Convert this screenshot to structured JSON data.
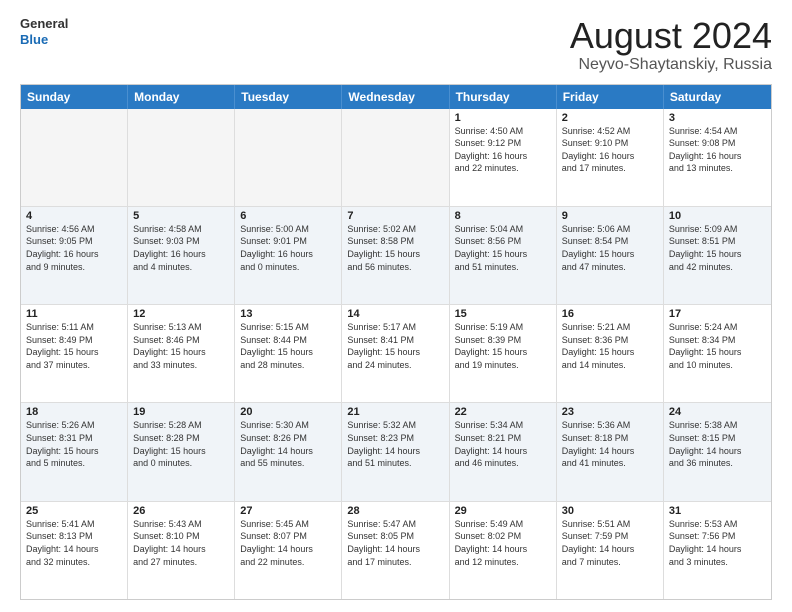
{
  "header": {
    "logo_line1": "General",
    "logo_line2": "Blue",
    "month": "August 2024",
    "location": "Neyvo-Shaytanskiy, Russia"
  },
  "weekdays": [
    "Sunday",
    "Monday",
    "Tuesday",
    "Wednesday",
    "Thursday",
    "Friday",
    "Saturday"
  ],
  "rows": [
    [
      {
        "day": "",
        "text": "",
        "empty": true
      },
      {
        "day": "",
        "text": "",
        "empty": true
      },
      {
        "day": "",
        "text": "",
        "empty": true
      },
      {
        "day": "",
        "text": "",
        "empty": true
      },
      {
        "day": "1",
        "text": "Sunrise: 4:50 AM\nSunset: 9:12 PM\nDaylight: 16 hours\nand 22 minutes."
      },
      {
        "day": "2",
        "text": "Sunrise: 4:52 AM\nSunset: 9:10 PM\nDaylight: 16 hours\nand 17 minutes."
      },
      {
        "day": "3",
        "text": "Sunrise: 4:54 AM\nSunset: 9:08 PM\nDaylight: 16 hours\nand 13 minutes."
      }
    ],
    [
      {
        "day": "4",
        "text": "Sunrise: 4:56 AM\nSunset: 9:05 PM\nDaylight: 16 hours\nand 9 minutes."
      },
      {
        "day": "5",
        "text": "Sunrise: 4:58 AM\nSunset: 9:03 PM\nDaylight: 16 hours\nand 4 minutes."
      },
      {
        "day": "6",
        "text": "Sunrise: 5:00 AM\nSunset: 9:01 PM\nDaylight: 16 hours\nand 0 minutes."
      },
      {
        "day": "7",
        "text": "Sunrise: 5:02 AM\nSunset: 8:58 PM\nDaylight: 15 hours\nand 56 minutes."
      },
      {
        "day": "8",
        "text": "Sunrise: 5:04 AM\nSunset: 8:56 PM\nDaylight: 15 hours\nand 51 minutes."
      },
      {
        "day": "9",
        "text": "Sunrise: 5:06 AM\nSunset: 8:54 PM\nDaylight: 15 hours\nand 47 minutes."
      },
      {
        "day": "10",
        "text": "Sunrise: 5:09 AM\nSunset: 8:51 PM\nDaylight: 15 hours\nand 42 minutes."
      }
    ],
    [
      {
        "day": "11",
        "text": "Sunrise: 5:11 AM\nSunset: 8:49 PM\nDaylight: 15 hours\nand 37 minutes."
      },
      {
        "day": "12",
        "text": "Sunrise: 5:13 AM\nSunset: 8:46 PM\nDaylight: 15 hours\nand 33 minutes."
      },
      {
        "day": "13",
        "text": "Sunrise: 5:15 AM\nSunset: 8:44 PM\nDaylight: 15 hours\nand 28 minutes."
      },
      {
        "day": "14",
        "text": "Sunrise: 5:17 AM\nSunset: 8:41 PM\nDaylight: 15 hours\nand 24 minutes."
      },
      {
        "day": "15",
        "text": "Sunrise: 5:19 AM\nSunset: 8:39 PM\nDaylight: 15 hours\nand 19 minutes."
      },
      {
        "day": "16",
        "text": "Sunrise: 5:21 AM\nSunset: 8:36 PM\nDaylight: 15 hours\nand 14 minutes."
      },
      {
        "day": "17",
        "text": "Sunrise: 5:24 AM\nSunset: 8:34 PM\nDaylight: 15 hours\nand 10 minutes."
      }
    ],
    [
      {
        "day": "18",
        "text": "Sunrise: 5:26 AM\nSunset: 8:31 PM\nDaylight: 15 hours\nand 5 minutes."
      },
      {
        "day": "19",
        "text": "Sunrise: 5:28 AM\nSunset: 8:28 PM\nDaylight: 15 hours\nand 0 minutes."
      },
      {
        "day": "20",
        "text": "Sunrise: 5:30 AM\nSunset: 8:26 PM\nDaylight: 14 hours\nand 55 minutes."
      },
      {
        "day": "21",
        "text": "Sunrise: 5:32 AM\nSunset: 8:23 PM\nDaylight: 14 hours\nand 51 minutes."
      },
      {
        "day": "22",
        "text": "Sunrise: 5:34 AM\nSunset: 8:21 PM\nDaylight: 14 hours\nand 46 minutes."
      },
      {
        "day": "23",
        "text": "Sunrise: 5:36 AM\nSunset: 8:18 PM\nDaylight: 14 hours\nand 41 minutes."
      },
      {
        "day": "24",
        "text": "Sunrise: 5:38 AM\nSunset: 8:15 PM\nDaylight: 14 hours\nand 36 minutes."
      }
    ],
    [
      {
        "day": "25",
        "text": "Sunrise: 5:41 AM\nSunset: 8:13 PM\nDaylight: 14 hours\nand 32 minutes."
      },
      {
        "day": "26",
        "text": "Sunrise: 5:43 AM\nSunset: 8:10 PM\nDaylight: 14 hours\nand 27 minutes."
      },
      {
        "day": "27",
        "text": "Sunrise: 5:45 AM\nSunset: 8:07 PM\nDaylight: 14 hours\nand 22 minutes."
      },
      {
        "day": "28",
        "text": "Sunrise: 5:47 AM\nSunset: 8:05 PM\nDaylight: 14 hours\nand 17 minutes."
      },
      {
        "day": "29",
        "text": "Sunrise: 5:49 AM\nSunset: 8:02 PM\nDaylight: 14 hours\nand 12 minutes."
      },
      {
        "day": "30",
        "text": "Sunrise: 5:51 AM\nSunset: 7:59 PM\nDaylight: 14 hours\nand 7 minutes."
      },
      {
        "day": "31",
        "text": "Sunrise: 5:53 AM\nSunset: 7:56 PM\nDaylight: 14 hours\nand 3 minutes."
      }
    ]
  ]
}
